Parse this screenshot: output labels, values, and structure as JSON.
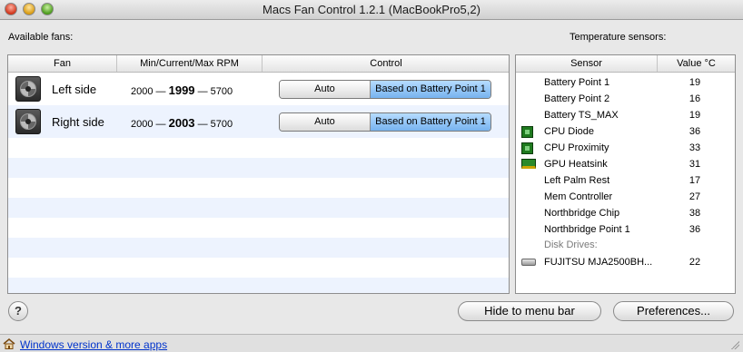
{
  "window": {
    "title": "Macs Fan Control 1.2.1 (MacBookPro5,2)"
  },
  "fans_section": {
    "label": "Available fans:",
    "columns": [
      "Fan",
      "Min/Current/Max RPM",
      "Control"
    ],
    "rows": [
      {
        "name": "Left side",
        "min": "2000",
        "current": "1999",
        "max": "5700",
        "auto_label": "Auto",
        "control_label": "Based on Battery Point 1"
      },
      {
        "name": "Right side",
        "min": "2000",
        "current": "2003",
        "max": "5700",
        "auto_label": "Auto",
        "control_label": "Based on Battery Point 1"
      }
    ],
    "dash": "—"
  },
  "sensors_section": {
    "label": "Temperature sensors:",
    "columns": [
      "Sensor",
      "Value °C"
    ],
    "rows": [
      {
        "name": "Battery Point 1",
        "value": "19",
        "icon": ""
      },
      {
        "name": "Battery Point 2",
        "value": "16",
        "icon": ""
      },
      {
        "name": "Battery TS_MAX",
        "value": "19",
        "icon": ""
      },
      {
        "name": "CPU Diode",
        "value": "36",
        "icon": "cpu-chip-icon"
      },
      {
        "name": "CPU Proximity",
        "value": "33",
        "icon": "cpu-chip-icon"
      },
      {
        "name": "GPU Heatsink",
        "value": "31",
        "icon": "gpu-card-icon"
      },
      {
        "name": "Left Palm Rest",
        "value": "17",
        "icon": ""
      },
      {
        "name": "Mem Controller",
        "value": "27",
        "icon": ""
      },
      {
        "name": "Northbridge Chip",
        "value": "38",
        "icon": ""
      },
      {
        "name": "Northbridge Point 1",
        "value": "36",
        "icon": ""
      }
    ],
    "group_label": "Disk Drives:",
    "disk": {
      "name": "FUJITSU MJA2500BH...",
      "value": "22",
      "icon": "hard-disk-icon"
    }
  },
  "buttons": {
    "help": "?",
    "hide": "Hide to menu bar",
    "preferences": "Preferences..."
  },
  "footer": {
    "link": "Windows version & more apps"
  }
}
